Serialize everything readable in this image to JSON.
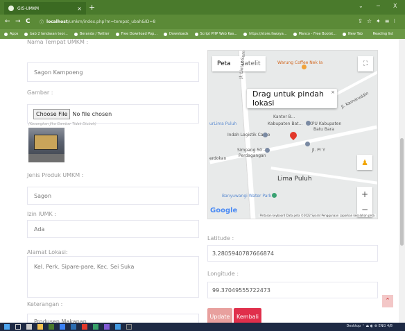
{
  "browser": {
    "tab_title": "GIS-UMKM",
    "tab_close": "×",
    "new_tab": "+",
    "url_host": "localhost",
    "url_rest": "/umkm/index.php?m=tempat_ubah&ID=8",
    "win_minimize": "⌄",
    "win_restore": "−",
    "win_close": "X",
    "nav_back": "←",
    "nav_forward": "→",
    "nav_reload": "C",
    "addr_icons": "⇪☆✦≡⁝",
    "bookmarks": [
      {
        "label": "Apps"
      },
      {
        "label": "bab 2 landasan teor..."
      },
      {
        "label": "Beranda / Twitter"
      },
      {
        "label": "Free Download Pop..."
      },
      {
        "label": "Downloads"
      },
      {
        "label": "Script PHP Web Kas..."
      },
      {
        "label": "https://store.fawzya..."
      },
      {
        "label": "Manco - Free Bootst..."
      },
      {
        "label": "New Tab"
      }
    ],
    "reading_list": "Reading list"
  },
  "form": {
    "nama_label": "Nama Tempat UMKM :",
    "nama_value": "Sagon Kampoeng",
    "gambar_label": "Gambar :",
    "file_button": "Choose File",
    "file_status": "No file chosen",
    "file_hint": "(Kosongkan Jika Gambar Tidak Diubah)",
    "jenis_label": "Jenis Produk UMKM :",
    "jenis_value": "Sagon",
    "izin_label": "Izin IUMK :",
    "izin_value": "Ada",
    "alamat_label": "Alamat Lokasi:",
    "alamat_value": "Kel. Perk. Sipare-pare, Kec. Sei Suka",
    "keterangan_label": "Keterangan :",
    "keterangan_value": "Produsen Makanan",
    "latitude_label": "Latitude :",
    "latitude_value": "3.2805940787666874",
    "longitude_label": "Longitude :",
    "longitude_value": "99.37049555722473",
    "update_button": "Update",
    "kembali_button": "Kembali"
  },
  "map": {
    "type_map": "Peta",
    "type_satellite": "Satelit",
    "fullscreen": "⛶",
    "tooltip": "Drag untuk pindah lokasi",
    "tooltip_close": "×",
    "zoom_in": "+",
    "zoom_out": "−",
    "pegman": "♟",
    "google": "Google",
    "footer": "Pintasan keyboard   Data peta ©2022   Syarat Penggunaan   Laporkan kesalahan peta",
    "labels": {
      "warung": "Warung Coffee Nek Ia",
      "lima_puluh_top": "urLima Puluh",
      "kantor": "Kantor B...",
      "kpu": "KPU Kabupaten",
      "batu_bara": "Batu Bara",
      "kabupaten": "Kabupaten Bat...",
      "indah": "Indah Logistik Cargo",
      "simpang": "Simpang 50 -",
      "perdagangan": "Perdagangan",
      "erdokan": "erdokan",
      "lima_puluh": "Lima Puluh",
      "banyuwangi": "Banyuwangi Water Park",
      "road_name": "Jl. Lintas Suma...",
      "kamardie": "Jl. Kamaruddin",
      "jl_r": "Jl. Pr Y"
    }
  },
  "page": {
    "scroll_top": "⌃"
  },
  "taskbar": {
    "tray": "Desktop  ⌃  ⏏  ◐  ⊕  ENG  4/8"
  }
}
